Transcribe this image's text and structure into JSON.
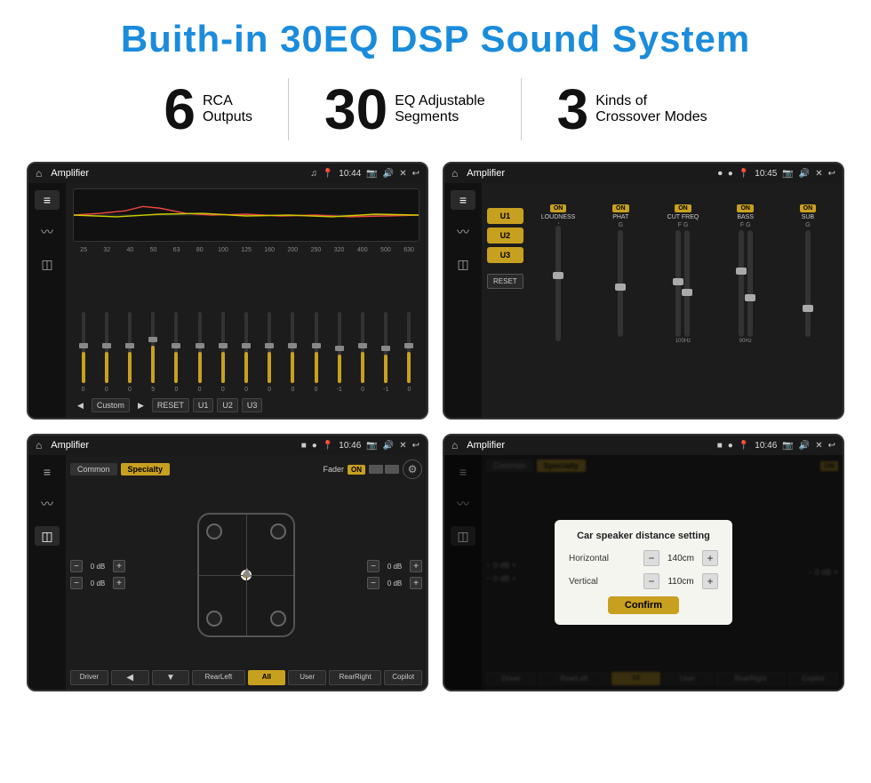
{
  "page": {
    "title": "Buith-in 30EQ DSP Sound System"
  },
  "stats": [
    {
      "number": "6",
      "label_line1": "RCA",
      "label_line2": "Outputs"
    },
    {
      "number": "30",
      "label_line1": "EQ Adjustable",
      "label_line2": "Segments"
    },
    {
      "number": "3",
      "label_line1": "Kinds of",
      "label_line2": "Crossover Modes"
    }
  ],
  "screen1": {
    "topbar": {
      "title": "Amplifier",
      "time": "10:44"
    },
    "eq_frequencies": [
      "25",
      "32",
      "40",
      "50",
      "63",
      "80",
      "100",
      "125",
      "160",
      "200",
      "250",
      "320",
      "400",
      "500",
      "630"
    ],
    "eq_values": [
      "0",
      "0",
      "0",
      "5",
      "0",
      "0",
      "0",
      "0",
      "0",
      "0",
      "0",
      "-1",
      "0",
      "-1"
    ],
    "bottom_buttons": [
      "Custom",
      "RESET",
      "U1",
      "U2",
      "U3"
    ]
  },
  "screen2": {
    "topbar": {
      "title": "Amplifier",
      "time": "10:45"
    },
    "presets": [
      "U1",
      "U2",
      "U3"
    ],
    "channels": [
      {
        "toggle": "ON",
        "name": "LOUDNESS"
      },
      {
        "toggle": "ON",
        "name": "PHAT"
      },
      {
        "toggle": "ON",
        "name": "CUT FREQ"
      },
      {
        "toggle": "ON",
        "name": "BASS"
      },
      {
        "toggle": "ON",
        "name": "SUB"
      }
    ],
    "reset_label": "RESET"
  },
  "screen3": {
    "topbar": {
      "title": "Amplifier",
      "time": "10:46"
    },
    "tabs": [
      "Common",
      "Specialty"
    ],
    "fader_label": "Fader",
    "on_badge": "ON",
    "db_controls": [
      {
        "value": "0 dB"
      },
      {
        "value": "0 dB"
      },
      {
        "value": "0 dB"
      },
      {
        "value": "0 dB"
      }
    ],
    "bottom_buttons": [
      "Driver",
      "RearLeft",
      "All",
      "User",
      "RearRight",
      "Copilot"
    ]
  },
  "screen4": {
    "topbar": {
      "title": "Amplifier",
      "time": "10:46"
    },
    "tabs": [
      "Common",
      "Specialty"
    ],
    "on_badge": "ON",
    "dialog": {
      "title": "Car speaker distance setting",
      "horizontal_label": "Horizontal",
      "horizontal_value": "140cm",
      "vertical_label": "Vertical",
      "vertical_value": "110cm",
      "confirm_label": "Confirm"
    },
    "db_controls_right": [
      {
        "value": "0 dB"
      },
      {
        "value": "0 dB"
      }
    ],
    "bottom_buttons": [
      "Driver",
      "RearLeft",
      "All",
      "User",
      "RearRight",
      "Copilot"
    ]
  }
}
